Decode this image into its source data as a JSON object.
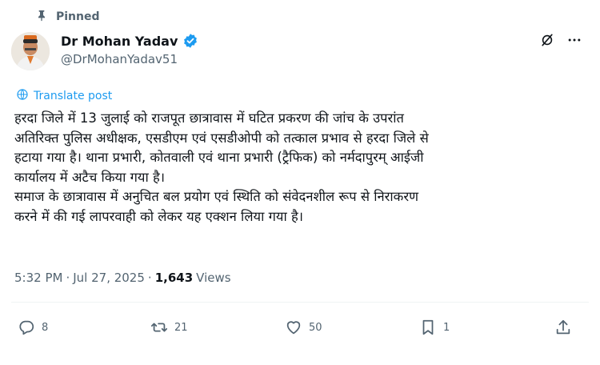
{
  "pinned": {
    "label": "Pinned",
    "icon": "pin-icon"
  },
  "author": {
    "name": "Dr Mohan Yadav",
    "handle": "@DrMohanYadav51",
    "verified_icon": "verified-badge-icon",
    "verified_color": "#1d9bf0"
  },
  "translate": {
    "label": "Translate post",
    "icon": "globe-icon"
  },
  "tweet": {
    "lines": [
      "हरदा जिले में 13 जुलाई को राजपूत छात्रावास में घटित प्रकरण की जांच के उपरांत",
      "अतिरिक्त पुलिस अधीक्षक, एसडीएम एवं एसडीओपी को तत्काल प्रभाव से हरदा जिले से",
      "हटाया गया है। थाना प्रभारी, कोतवाली एवं थाना प्रभारी (ट्रैफिक) को नर्मदापुरम् आईजी",
      "कार्यालय में अटैच किया गया है।",
      "समाज के छात्रावास में अनुचित बल प्रयोग एवं स्थिति को संवेदनशील रूप से निराकरण",
      "करने में की गई लापरवाही को लेकर यह एक्शन लिया गया है।"
    ]
  },
  "meta": {
    "time": "5:32 PM",
    "sep1": "·",
    "date": "Jul 27, 2025",
    "sep2": "·",
    "views_count": "1,643",
    "views_label": "Views"
  },
  "actions": {
    "reply_count": "8",
    "retweet_count": "21",
    "like_count": "50",
    "bookmark_count": "1"
  },
  "colors": {
    "text": "#0f1419",
    "secondary": "#536471",
    "accent": "#1d9bf0"
  }
}
